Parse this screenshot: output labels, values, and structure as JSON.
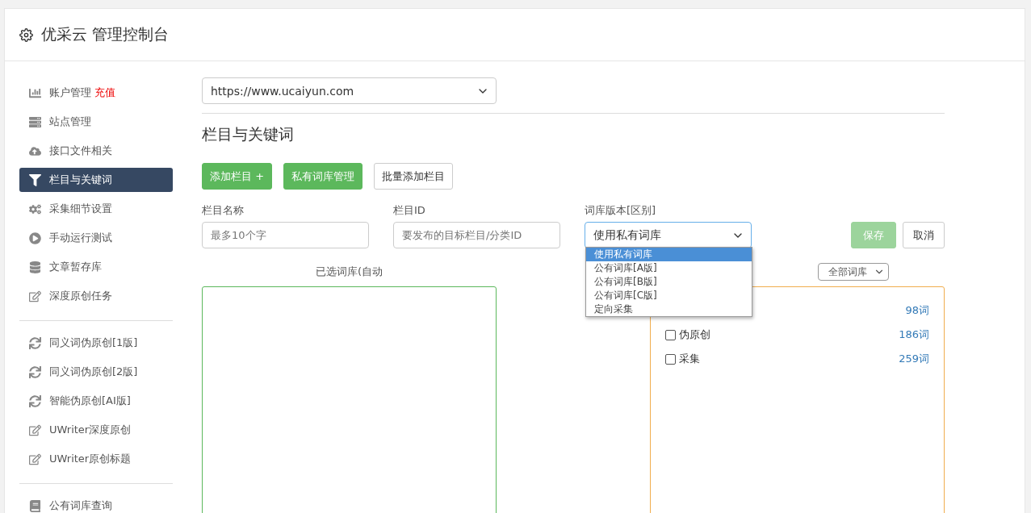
{
  "header": {
    "title": "优采云 管理控制台"
  },
  "sidebar": {
    "groups": [
      {
        "items": [
          {
            "label": "账户管理",
            "badge": "充值",
            "selected": false
          },
          {
            "label": "站点管理",
            "selected": false
          },
          {
            "label": "接口文件相关",
            "selected": false
          },
          {
            "label": "栏目与关键词",
            "selected": true
          },
          {
            "label": "采集细节设置",
            "selected": false
          },
          {
            "label": "手动运行测试",
            "selected": false
          },
          {
            "label": "文章暂存库",
            "selected": false
          },
          {
            "label": "深度原创任务",
            "selected": false
          }
        ]
      },
      {
        "items": [
          {
            "label": "同义词伪原创[1版]",
            "selected": false
          },
          {
            "label": "同义词伪原创[2版]",
            "selected": false
          },
          {
            "label": "智能伪原创[AI版]",
            "selected": false
          },
          {
            "label": "UWriter深度原创",
            "selected": false
          },
          {
            "label": "UWriter原创标题",
            "selected": false
          }
        ]
      },
      {
        "items": [
          {
            "label": "公有词库查询",
            "selected": false
          }
        ]
      }
    ]
  },
  "site_select": {
    "value": "https://www.ucaiyun.com"
  },
  "section_title": "栏目与关键词",
  "actions": [
    {
      "label": "添加栏目 +",
      "kind": "success"
    },
    {
      "label": "私有词库管理",
      "kind": "success"
    },
    {
      "label": "批量添加栏目",
      "kind": "default"
    }
  ],
  "form": {
    "fields": [
      {
        "label": "栏目名称",
        "placeholder": "最多10个字"
      },
      {
        "label": "栏目ID",
        "placeholder": "要发布的目标栏目/分类ID"
      }
    ],
    "library": {
      "label": "词库版本[区别]",
      "value": "使用私有词库",
      "expanded": true,
      "options": [
        {
          "label": "使用私有词库",
          "selected": true
        },
        {
          "label": "公有词库[A版]",
          "selected": false
        },
        {
          "label": "公有词库[B版]",
          "selected": false
        },
        {
          "label": "公有词库[C版]",
          "selected": false
        },
        {
          "label": "定向采集",
          "selected": false
        }
      ]
    },
    "save": {
      "label": "保存",
      "disabled": true
    },
    "cancel": {
      "label": "取消"
    }
  },
  "selected_panel": {
    "title": "已选词库(自动"
  },
  "library_panel": {
    "filter": "全部词库",
    "rows": [
      {
        "count": "98词"
      },
      {
        "label": "伪原创",
        "count": "186词",
        "checked": false
      },
      {
        "label": "采集",
        "count": "259词",
        "checked": false
      }
    ]
  }
}
